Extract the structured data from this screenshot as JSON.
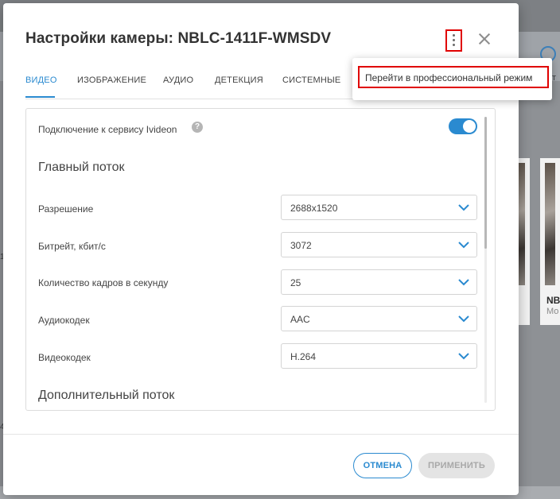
{
  "background": {
    "card_title": "NB",
    "card_subtitle": "Мо",
    "side_letter": "т",
    "edge_num_1": "1",
    "edge_num_2": "4"
  },
  "dialog": {
    "title": "Настройки камеры: NBLC-1411F-WMSDV",
    "menu_icon": "more-vertical-icon",
    "close_icon": "close-icon"
  },
  "tabs": [
    {
      "label": "ВИДЕО",
      "active": true
    },
    {
      "label": "ИЗОБРАЖЕНИЕ",
      "active": false
    },
    {
      "label": "АУДИО",
      "active": false
    },
    {
      "label": "ДЕТЕКЦИЯ",
      "active": false
    },
    {
      "label": "СИСТЕМНЫЕ",
      "active": false
    }
  ],
  "ivideon": {
    "label": "Подключение к сервису Ivideon",
    "help": "?",
    "enabled": true
  },
  "main_stream": {
    "title": "Главный поток",
    "fields": [
      {
        "label": "Разрешение",
        "value": "2688x1520"
      },
      {
        "label": "Битрейт, кбит/с",
        "value": "3072"
      },
      {
        "label": "Количество кадров в секунду",
        "value": "25"
      },
      {
        "label": "Аудиокодек",
        "value": "AAC"
      },
      {
        "label": "Видеокодек",
        "value": "H.264"
      }
    ]
  },
  "extra_stream": {
    "title": "Дополнительный поток"
  },
  "footer": {
    "cancel_label": "ОТМЕНА",
    "apply_label": "ПРИМЕНИТЬ"
  },
  "menu_popup": {
    "item_label": "Перейти в профессиональный режим"
  },
  "colors": {
    "accent": "#2a8ad0",
    "highlight": "#e00000"
  }
}
